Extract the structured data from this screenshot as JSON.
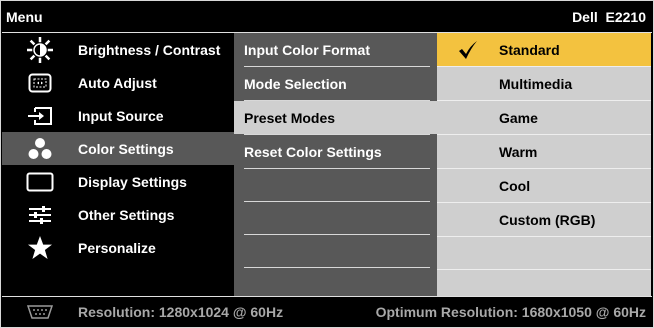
{
  "header": {
    "menu_title": "Menu",
    "model": "Dell  E2210"
  },
  "left_menu": [
    {
      "label": "Brightness / Contrast",
      "icon": "brightness-icon",
      "selected": false
    },
    {
      "label": "Auto Adjust",
      "icon": "auto-adjust-icon",
      "selected": false
    },
    {
      "label": "Input Source",
      "icon": "input-source-icon",
      "selected": false
    },
    {
      "label": "Color Settings",
      "icon": "color-settings-icon",
      "selected": true
    },
    {
      "label": "Display Settings",
      "icon": "display-settings-icon",
      "selected": false
    },
    {
      "label": "Other Settings",
      "icon": "other-settings-icon",
      "selected": false
    },
    {
      "label": "Personalize",
      "icon": "star-icon",
      "selected": false
    }
  ],
  "middle_menu": [
    {
      "label": "Input Color Format",
      "highlighted": false
    },
    {
      "label": "Mode Selection",
      "highlighted": false
    },
    {
      "label": "Preset Modes",
      "highlighted": true
    },
    {
      "label": "Reset Color Settings",
      "highlighted": false
    }
  ],
  "options": [
    {
      "label": "Standard",
      "checked": true
    },
    {
      "label": "Multimedia",
      "checked": false
    },
    {
      "label": "Game",
      "checked": false
    },
    {
      "label": "Warm",
      "checked": false
    },
    {
      "label": "Cool",
      "checked": false
    },
    {
      "label": "Custom (RGB)",
      "checked": false
    }
  ],
  "footer": {
    "connector_icon": "vga-connector-icon",
    "resolution": "Resolution: 1280x1024 @ 60Hz",
    "optimum_resolution": "Optimum Resolution: 1680x1050 @ 60Hz"
  },
  "colors": {
    "selected_item": "#585858",
    "panel_light": "#cfcfcf",
    "active_option": "#f3c23f",
    "footer_text": "#a8a8a8"
  }
}
